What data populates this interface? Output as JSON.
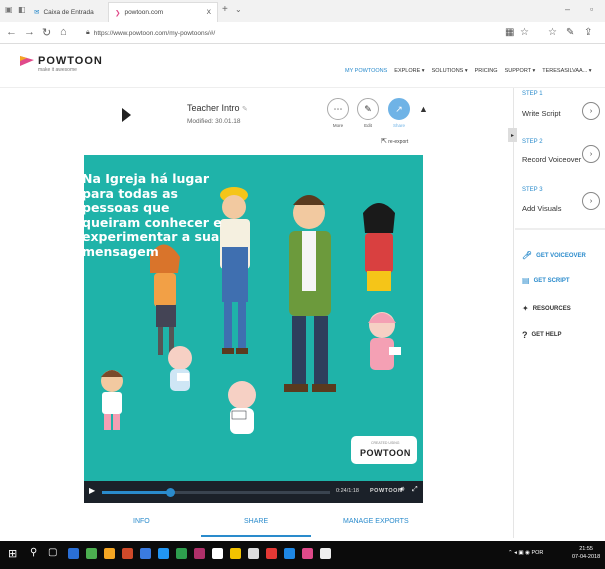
{
  "browser": {
    "tabs": [
      {
        "label": "Caixa de Entrada",
        "icon": "mail-icon"
      },
      {
        "label": "powtoon.com",
        "icon": "powtoon-icon"
      }
    ],
    "url": "https://www.powtoon.com/my-powtoons/#/",
    "new_tab_symbol": "+",
    "close_symbol": "X"
  },
  "site": {
    "logo_text": "POWTOON",
    "logo_tagline": "make it awesome",
    "nav": [
      "MY POWTOONS",
      "EXPLORE ▾",
      "SOLUTIONS ▾",
      "PRICING",
      "SUPPORT ▾",
      "TERESASILVAA... ▾"
    ]
  },
  "video": {
    "title": "Teacher Intro",
    "modified": "Modified: 30.01.18",
    "actions": [
      {
        "label": "More",
        "icon": "more-icon"
      },
      {
        "label": "Edit",
        "icon": "edit-icon"
      },
      {
        "label": "Share",
        "icon": "share-icon"
      }
    ],
    "reexport": "re-export",
    "overlay_text": "Na Igreja há lugar para todas as pessoas que queiram conhecer e experimentar a sua mensagem",
    "badge_small": "CREATED USING",
    "badge_brand": "POWTOON",
    "time": "0:24/1:18",
    "control_brand": "POWTOON",
    "progress": 0.3,
    "tabs": [
      "INFO",
      "SHARE",
      "MANAGE EXPORTS"
    ],
    "active_tab": "SHARE"
  },
  "panel": {
    "steps": [
      {
        "label": "STEP 1",
        "text": "Write Script"
      },
      {
        "label": "STEP 2",
        "text": "Record Voiceover"
      },
      {
        "label": "STEP 3",
        "text": "Add Visuals"
      }
    ],
    "links": [
      {
        "label": "GET VOICEOVER",
        "icon": "microphone-icon"
      },
      {
        "label": "GET SCRIPT",
        "icon": "script-icon"
      },
      {
        "label": "RESOURCES",
        "icon": "resources-icon"
      },
      {
        "label": "GET HELP",
        "icon": "help-icon"
      }
    ]
  },
  "taskbar": {
    "time": "21:55",
    "date": "07-04-2018",
    "lang": "POR"
  },
  "colors": {
    "accent": "#2a8bcc",
    "video_bg": "#1fb3a9",
    "control_bar": "#1b2129"
  }
}
